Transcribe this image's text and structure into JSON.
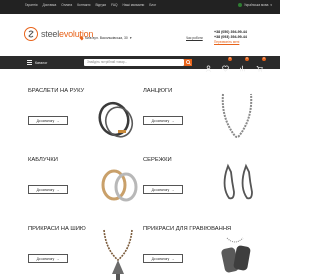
{
  "topnav": [
    "Гарантія",
    "Доставка",
    "Оплата",
    "Контакти",
    "Відгуки",
    "FAQ",
    "Наші магазини",
    "Блог"
  ],
  "language": "Українська мова",
  "logo": {
    "part1": "steel",
    "part2": "evolution"
  },
  "address": "Київ вул. Васильківська, 30",
  "schedule": "Час роботи",
  "phones": [
    "+38 (050) 394-99-44",
    "+38 (093) 394-99-44"
  ],
  "callback": "Перезвоніть мені",
  "menu": {
    "label": "Каталог"
  },
  "search": {
    "placeholder": "Знайдіть потрібний товар..."
  },
  "badges": {
    "wishlist": "0",
    "compare": "0",
    "cart": "0"
  },
  "categories": [
    {
      "title": "БРАСЛЕТИ НА РУКУ",
      "button": "До каталогу"
    },
    {
      "title": "ЛАНЦЮГИ",
      "button": "До каталогу"
    },
    {
      "title": "КАБЛУЧКИ",
      "button": "До каталогу"
    },
    {
      "title": "СЕРЕЖКИ",
      "button": "До каталогу"
    },
    {
      "title": "ПРИКРАСИ НА ШИЮ",
      "button": "До каталогу"
    },
    {
      "title": "ПРИКРАСИ ДЛЯ ГРАВІЮВАННЯ",
      "button": "До каталогу"
    }
  ],
  "colors": {
    "accent": "#e8631a",
    "dark": "#2b2b2b",
    "topbar": "#222222"
  },
  "icons": [
    "menu-icon",
    "search-icon",
    "user-icon",
    "heart-icon",
    "compare-icon",
    "cart-icon",
    "location-pin-icon",
    "arrow-right-icon"
  ]
}
